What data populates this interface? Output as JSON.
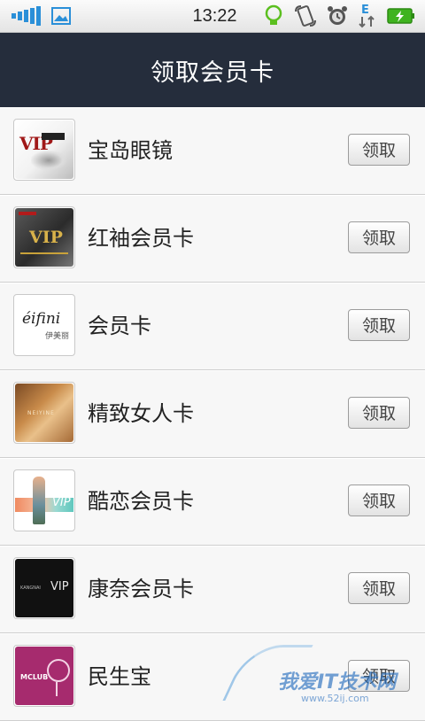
{
  "status_bar": {
    "time": "13:22",
    "icons": [
      "signal-icon",
      "gallery-icon",
      "bulb-icon",
      "rotate-icon",
      "alarm-icon",
      "e-data-icon",
      "battery-charging-icon"
    ],
    "data_label": "E"
  },
  "header": {
    "title": "领取会员卡"
  },
  "cards": [
    {
      "name": "宝岛眼镜",
      "button": "领取",
      "thumb": "vip-white-card"
    },
    {
      "name": "红袖会员卡",
      "button": "领取",
      "thumb": "vip-dark-card"
    },
    {
      "name": "会员卡",
      "button": "领取",
      "thumb": "eifini-card"
    },
    {
      "name": "精致女人卡",
      "button": "领取",
      "thumb": "gold-card"
    },
    {
      "name": "酷恋会员卡",
      "button": "领取",
      "thumb": "coolove-card"
    },
    {
      "name": "康奈会员卡",
      "button": "领取",
      "thumb": "kangnai-card"
    },
    {
      "name": "民生宝",
      "button": "领取",
      "thumb": "mclub-card"
    }
  ],
  "thumb_text": {
    "vip1": "VIP",
    "vip2": "VIP",
    "eifini_logo": "éifini",
    "eifini_sub": "伊美丽",
    "gold": "NEIYINE",
    "coolove": "VIP",
    "kangnai_text": "KANGNAI",
    "kangnai_vip": "VIP",
    "mclub": "MCLUB"
  },
  "watermark": {
    "text": "我爱IT技术网",
    "url": "www.52ij.com"
  },
  "colors": {
    "header_bg": "#252d3c",
    "list_bg": "#f7f7f7",
    "accent_status": "#2a8fd8"
  }
}
